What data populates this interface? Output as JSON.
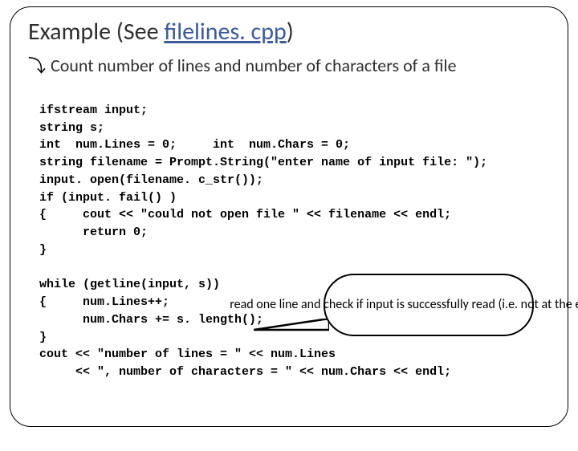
{
  "title_prefix": "Example (See ",
  "title_filename": "filelines. cpp",
  "title_suffix": ")",
  "bullet_text": "Count number of lines and number of characters of a file",
  "code_lines": [
    "ifstream input;",
    "string s;",
    "int  num.Lines = 0;     int  num.Chars = 0;",
    "string filename = Prompt.String(\"enter name of input file: \");",
    "input. open(filename. c_str());",
    "if (input. fail() )",
    "{     cout << \"could not open file \" << filename << endl;",
    "      return 0;",
    "}",
    "",
    "while (getline(input, s))",
    "{     num.Lines++;",
    "      num.Chars += s. length();",
    "}",
    "cout << \"number of lines = \" << num.Lines",
    "     << \", number of characters = \" << num.Chars << endl;"
  ],
  "callout_text": "read one line and check if input is successfully read (i.e. not at the end of file"
}
